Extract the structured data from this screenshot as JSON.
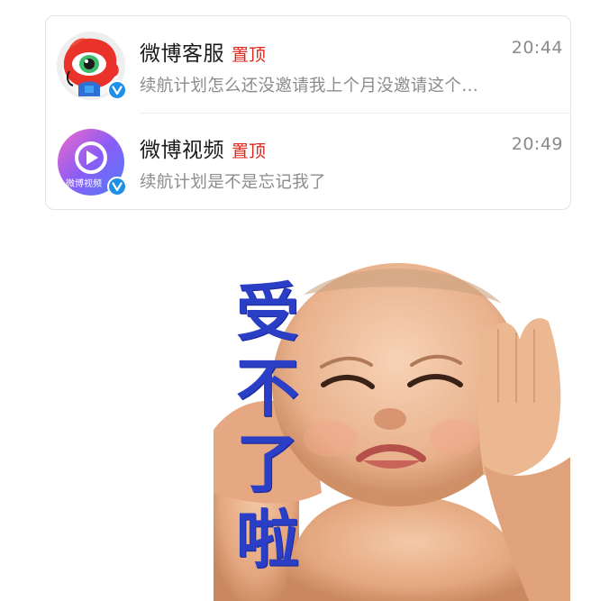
{
  "chats": [
    {
      "name": "微博客服",
      "pin_label": "置顶",
      "time": "20:44",
      "preview": "续航计划怎么还没邀请我上个月没邀请这个…",
      "avatar_icon": "weibo-customer-service-mascot-icon",
      "verified_icon": "verified-v-icon"
    },
    {
      "name": "微博视频",
      "pin_label": "置顶",
      "time": "20:49",
      "preview": "续航计划是不是忘记我了",
      "avatar_icon": "weibo-video-play-icon",
      "avatar_text": "微博视频",
      "verified_icon": "verified-v-icon"
    }
  ],
  "meme": {
    "caption": [
      "受",
      "不",
      "了",
      "啦"
    ],
    "caption_color": "#2a3ec6"
  },
  "colors": {
    "pin": "#e2261f",
    "verified": "#1e90e8",
    "time": "#8a8a8a",
    "preview": "#8c8c8c"
  }
}
